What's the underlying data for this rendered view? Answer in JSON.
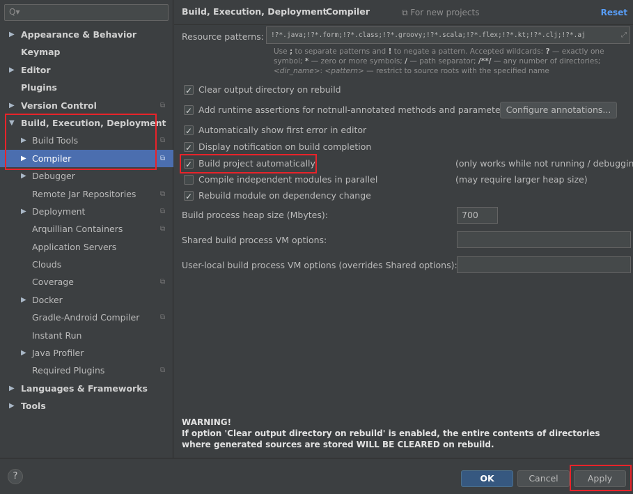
{
  "search": {
    "icon": "search-icon",
    "placeholder": ""
  },
  "sidebar": {
    "items": [
      {
        "label": "Appearance & Behavior",
        "arrow": "▶"
      },
      {
        "label": "Keymap",
        "arrow": ""
      },
      {
        "label": "Editor",
        "arrow": "▶"
      },
      {
        "label": "Plugins",
        "arrow": ""
      },
      {
        "label": "Version Control",
        "arrow": "▶",
        "project_scoped": true
      },
      {
        "label": "Build, Execution, Deployment",
        "arrow": "▼"
      },
      {
        "label": "Build Tools",
        "arrow": "▶",
        "project_scoped": true
      },
      {
        "label": "Compiler",
        "arrow": "▶",
        "project_scoped": true,
        "selected": true
      },
      {
        "label": "Debugger",
        "arrow": "▶"
      },
      {
        "label": "Remote Jar Repositories",
        "arrow": "",
        "project_scoped": true
      },
      {
        "label": "Deployment",
        "arrow": "▶",
        "project_scoped": true
      },
      {
        "label": "Arquillian Containers",
        "arrow": "",
        "project_scoped": true
      },
      {
        "label": "Application Servers",
        "arrow": ""
      },
      {
        "label": "Clouds",
        "arrow": ""
      },
      {
        "label": "Coverage",
        "arrow": "",
        "project_scoped": true
      },
      {
        "label": "Docker",
        "arrow": "▶"
      },
      {
        "label": "Gradle-Android Compiler",
        "arrow": "",
        "project_scoped": true
      },
      {
        "label": "Instant Run",
        "arrow": ""
      },
      {
        "label": "Java Profiler",
        "arrow": "▶"
      },
      {
        "label": "Required Plugins",
        "arrow": "",
        "project_scoped": true
      },
      {
        "label": "Languages & Frameworks",
        "arrow": "▶"
      },
      {
        "label": "Tools",
        "arrow": "▶"
      }
    ],
    "project_icon_glyph": "⧉"
  },
  "header": {
    "breadcrumb_parent": "Build, Execution, Deployment",
    "breadcrumb_separator": "›",
    "breadcrumb_current": "Compiler",
    "new_projects_icon": "⧉",
    "new_projects_label": "For new projects",
    "reset_label": "Reset"
  },
  "resource_patterns": {
    "label": "Resource patterns:",
    "value": "!?*.java;!?*.form;!?*.class;!?*.groovy;!?*.scala;!?*.flex;!?*.kt;!?*.clj;!?*.aj",
    "expand_glyph": "⤢",
    "help": {
      "p1": "Use ",
      "b1": ";",
      "p2": " to separate patterns and ",
      "b2": "!",
      "p3": " to negate a pattern. Accepted wildcards: ",
      "b3": "?",
      "p4": " — exactly one symbol; ",
      "b4": "*",
      "p5": " — zero or more symbols; ",
      "b5": "/",
      "p6": " — path separator; ",
      "b6": "/**/",
      "p7": " — any number of directories; ",
      "i1": "<dir_name>",
      "p8": ":",
      "i2": "<pattern>",
      "p9": " — restrict to source roots with the specified name"
    }
  },
  "options": {
    "clear_output": {
      "label": "Clear output directory on rebuild",
      "checked": true
    },
    "runtime_assertions": {
      "label": "Add runtime assertions for notnull-annotated methods and parameters",
      "checked": true
    },
    "configure_annotations_label": "Configure annotations...",
    "show_first_error": {
      "label": "Automatically show first error in editor",
      "checked": true
    },
    "notification": {
      "label": "Display notification on build completion",
      "checked": true
    },
    "build_auto": {
      "label": "Build project automatically",
      "checked": true,
      "note": "(only works while not running / debugging)"
    },
    "parallel": {
      "label": "Compile independent modules in parallel",
      "checked": false,
      "note": "(may require larger heap size)"
    },
    "rebuild_dep": {
      "label": "Rebuild module on dependency change",
      "checked": true
    }
  },
  "fields": {
    "heap_label": "Build process heap size (Mbytes):",
    "heap_value": "700",
    "shared_vm_label": "Shared build process VM options:",
    "shared_vm_value": "",
    "user_vm_label": "User-local build process VM options (overrides Shared options):",
    "user_vm_value": ""
  },
  "warning": {
    "title": "WARNING!",
    "body": "If option 'Clear output directory on rebuild' is enabled, the entire contents of directories where generated sources are stored WILL BE CLEARED on rebuild."
  },
  "footer": {
    "help_label": "?",
    "ok_label": "OK",
    "cancel_label": "Cancel",
    "apply_label": "Apply"
  },
  "colors": {
    "background": "#3c3f41",
    "selection": "#4b6eaf",
    "highlight_box": "#e8232a",
    "link": "#589df6",
    "ok_button": "#365880"
  }
}
